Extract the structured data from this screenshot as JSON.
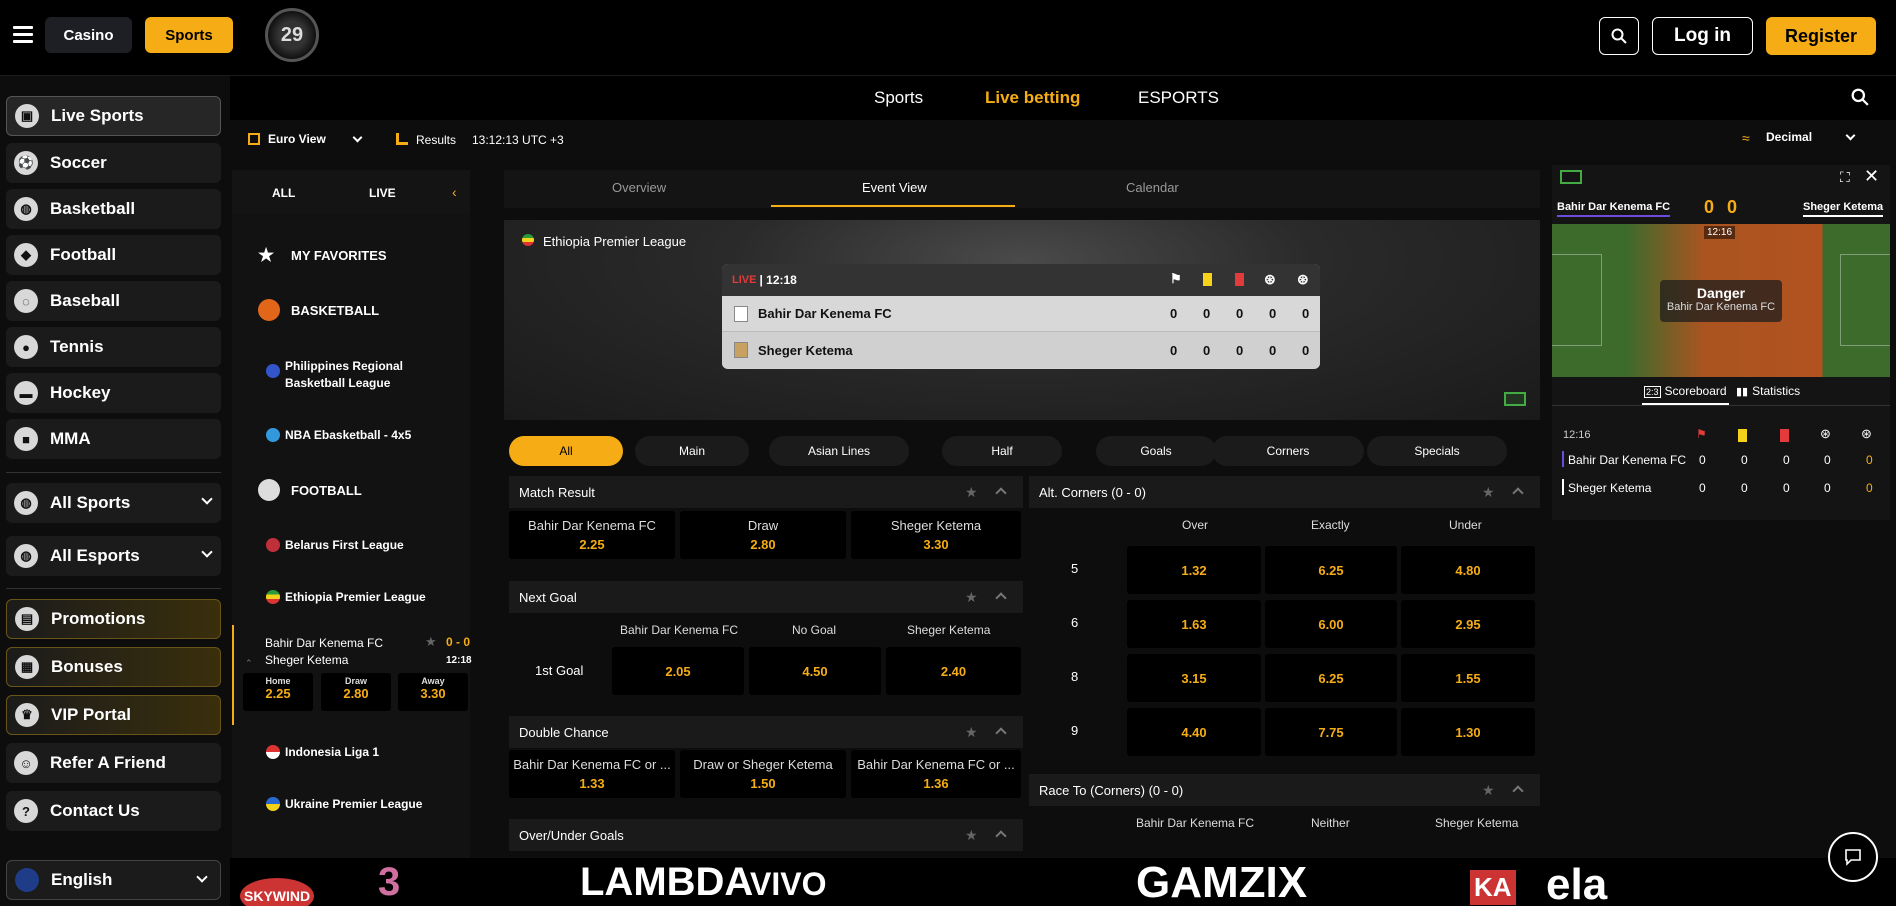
{
  "header": {
    "casino": "Casino",
    "sports": "Sports",
    "logo_text": "29",
    "login": "Log in",
    "register": "Register"
  },
  "sidebar": {
    "items": [
      {
        "label": "Live Sports",
        "icon": "calendar-icon"
      },
      {
        "label": "Soccer",
        "icon": "soccer-icon"
      },
      {
        "label": "Basketball",
        "icon": "basketball-icon"
      },
      {
        "label": "Football",
        "icon": "football-icon"
      },
      {
        "label": "Baseball",
        "icon": "baseball-icon"
      },
      {
        "label": "Tennis",
        "icon": "tennis-icon"
      },
      {
        "label": "Hockey",
        "icon": "hockey-icon"
      },
      {
        "label": "MMA",
        "icon": "mma-icon"
      }
    ],
    "all_sports": "All Sports",
    "all_esports": "All Esports",
    "promo": [
      {
        "label": "Promotions",
        "icon": "promotions-icon"
      },
      {
        "label": "Bonuses",
        "icon": "gift-icon"
      },
      {
        "label": "VIP Portal",
        "icon": "crown-icon"
      }
    ],
    "refer": "Refer A Friend",
    "contact": "Contact Us",
    "language": "English"
  },
  "subnav": {
    "sports": "Sports",
    "live": "Live betting",
    "esports": "ESPORTS"
  },
  "toolbar": {
    "view": "Euro View",
    "results": "Results",
    "time": "13:12:13 UTC +3",
    "odds_format": "Decimal"
  },
  "leftlist": {
    "all": "ALL",
    "live": "LIVE",
    "favorites": "MY FAVORITES",
    "basketball": "BASKETBALL",
    "ph_league": "Philippines Regional Basketball League",
    "nba": "NBA Ebasketball - 4x5",
    "football": "FOOTBALL",
    "belarus": "Belarus First League",
    "ethiopia": "Ethiopia Premier League",
    "match_home": "Bahir Dar Kenema FC",
    "match_away": "Sheger Ketema",
    "match_score": "0 - 0",
    "match_time": "12:18",
    "home_lbl": "Home",
    "draw_lbl": "Draw",
    "away_lbl": "Away",
    "home_odd": "2.25",
    "draw_odd": "2.80",
    "away_odd": "3.30",
    "indonesia": "Indonesia Liga 1",
    "ukraine": "Ukraine Premier League"
  },
  "eventtabs": {
    "overview": "Overview",
    "event": "Event View",
    "calendar": "Calendar"
  },
  "event": {
    "league": "Ethiopia Premier League",
    "live": "LIVE",
    "clock": "| 12:18",
    "home": "Bahir Dar Kenema FC",
    "away": "Sheger Ketema",
    "home_scores": [
      "0",
      "0",
      "0",
      "0",
      "0"
    ],
    "away_scores": [
      "0",
      "0",
      "0",
      "0",
      "0"
    ]
  },
  "filters": [
    "All",
    "Main",
    "Asian Lines",
    "Half",
    "Goals",
    "Corners",
    "Specials"
  ],
  "markets": {
    "match_result": {
      "title": "Match Result",
      "outcomes": [
        {
          "label": "Bahir Dar Kenema FC",
          "odd": "2.25"
        },
        {
          "label": "Draw",
          "odd": "2.80"
        },
        {
          "label": "Sheger Ketema",
          "odd": "3.30"
        }
      ]
    },
    "next_goal": {
      "title": "Next Goal",
      "headers": [
        "Bahir Dar Kenema FC",
        "No Goal",
        "Sheger Ketema"
      ],
      "row_label": "1st Goal",
      "odds": [
        "2.05",
        "4.50",
        "2.40"
      ]
    },
    "double_chance": {
      "title": "Double Chance",
      "outcomes": [
        {
          "label": "Bahir Dar Kenema FC or ...",
          "odd": "1.33"
        },
        {
          "label": "Draw or Sheger Ketema",
          "odd": "1.50"
        },
        {
          "label": "Bahir Dar Kenema FC or ...",
          "odd": "1.36"
        }
      ]
    },
    "over_under": {
      "title": "Over/Under Goals"
    },
    "alt_corners": {
      "title": "Alt. Corners  (0 - 0)",
      "headers": [
        "Over",
        "Exactly",
        "Under"
      ],
      "rows": [
        {
          "line": "5",
          "odds": [
            "1.32",
            "6.25",
            "4.80"
          ]
        },
        {
          "line": "6",
          "odds": [
            "1.63",
            "6.00",
            "2.95"
          ]
        },
        {
          "line": "8",
          "odds": [
            "3.15",
            "6.25",
            "1.55"
          ]
        },
        {
          "line": "9",
          "odds": [
            "4.40",
            "7.75",
            "1.30"
          ]
        }
      ]
    },
    "race_corners": {
      "title": "Race To (Corners)  (0 - 0)",
      "headers": [
        "Bahir Dar Kenema FC",
        "Neither",
        "Sheger Ketema"
      ]
    }
  },
  "tracker": {
    "home": "Bahir Dar Kenema FC",
    "away": "Sheger Ketema",
    "score_home": "0",
    "score_away": "0",
    "clock": "12:16",
    "danger": "Danger",
    "danger_team": "Bahir Dar Kenema FC",
    "tab_scoreboard": "Scoreboard",
    "tab_stats": "Statistics",
    "time": "12:16",
    "rows": [
      {
        "team": "Bahir Dar Kenema FC",
        "vals": [
          "0",
          "0",
          "0",
          "0",
          "0"
        ]
      },
      {
        "team": "Sheger Ketema",
        "vals": [
          "0",
          "0",
          "0",
          "0",
          "0"
        ]
      }
    ]
  },
  "providers": [
    "SKYWIND",
    "3",
    "LAMBDA",
    "VIVO",
    "GAMZIX",
    "KA",
    "ela"
  ],
  "colors": {
    "accent": "#f6ad15",
    "bg": "#0d0d0d",
    "danger": "#e33b3b"
  }
}
